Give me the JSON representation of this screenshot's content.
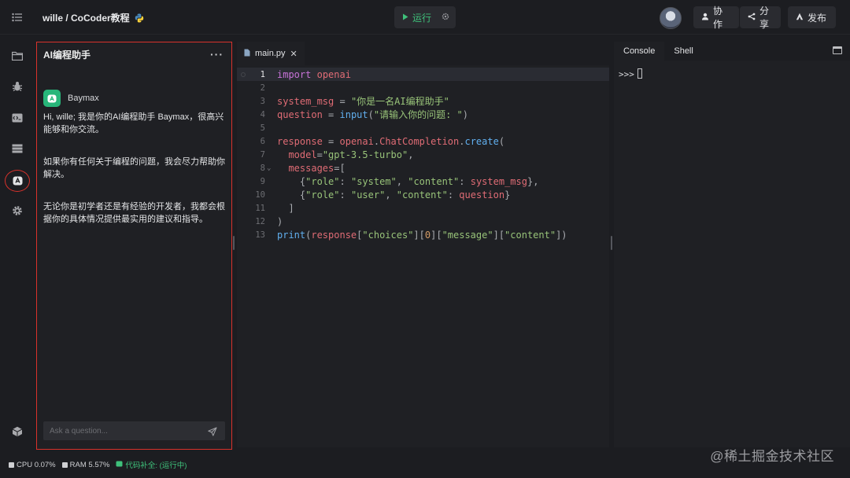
{
  "header": {
    "project_title": "wille / CoCoder教程",
    "run_label": "运行",
    "collab_label": "协作",
    "share_label": "分享",
    "publish_label": "发布"
  },
  "rail": {
    "icons": [
      "files-icon",
      "debug-icon",
      "code-snippet-icon",
      "database-icon",
      "ai-assistant-icon",
      "settings-icon",
      "packages-icon"
    ],
    "active": "ai-assistant-icon"
  },
  "ai_panel": {
    "title": "AI编程助手",
    "bot_name": "Baymax",
    "messages": [
      "Hi, wille; 我是你的AI编程助手 Baymax，很高兴能够和你交流。",
      "如果你有任何关于编程的问题，我会尽力帮助你解决。",
      "无论你是初学者还是有经验的开发者，我都会根据你的具体情况提供最实用的建议和指导。"
    ],
    "input_placeholder": "Ask a question..."
  },
  "editor": {
    "tab_name": "main.py",
    "active_line": 1,
    "line_numbers": [
      "1",
      "2",
      "3",
      "4",
      "5",
      "6",
      "7",
      "8",
      "9",
      "10",
      "11",
      "12",
      "13"
    ]
  },
  "console": {
    "tabs": [
      "Console",
      "Shell"
    ],
    "active_tab": "Console",
    "prompt": ">>>"
  },
  "status": {
    "cpu": "CPU 0.07%",
    "ram": "RAM 5.57%",
    "completion": "代码补全: (运行中)"
  },
  "watermark": "@稀土掘金技术社区",
  "colors": {
    "accent_green": "#3ec07a",
    "highlight_red": "#d9322b",
    "bot_green": "#28b67a"
  }
}
